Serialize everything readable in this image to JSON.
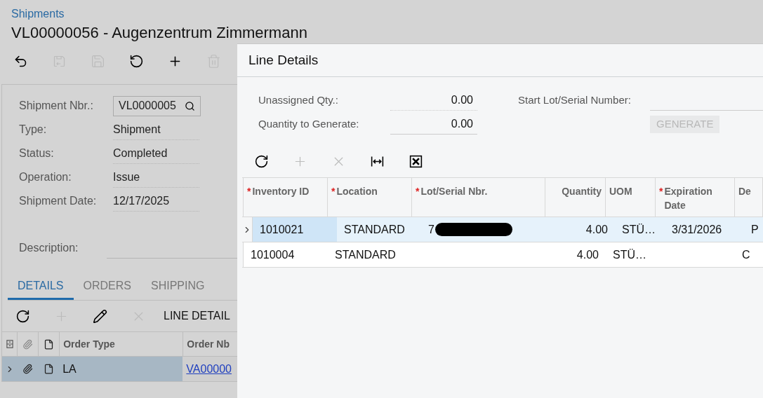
{
  "breadcrumb": "Shipments",
  "title": "VL00000056 - Augenzentrum Zimmermann",
  "toolbar": [
    {
      "kind": "back",
      "disabled": false
    },
    {
      "kind": "save-close",
      "disabled": true
    },
    {
      "kind": "save",
      "disabled": true
    },
    {
      "kind": "undo",
      "disabled": false
    },
    {
      "kind": "add",
      "disabled": false
    },
    {
      "kind": "delete",
      "disabled": true
    }
  ],
  "form": [
    {
      "label": "Shipment Nbr.:",
      "value": "VL0000005",
      "kind": "lookup"
    },
    {
      "label": "Type:",
      "value": "Shipment",
      "kind": "text"
    },
    {
      "label": "Status:",
      "value": "Completed",
      "kind": "text"
    },
    {
      "label": "Operation:",
      "value": "Issue",
      "kind": "text"
    },
    {
      "label": "Shipment Date:",
      "value": "12/17/2025",
      "kind": "text"
    },
    {
      "label": "Description:",
      "kind": "text"
    }
  ],
  "tabs": [
    {
      "label": "DETAILS",
      "selected": true
    },
    {
      "label": "ORDERS",
      "selected": false
    },
    {
      "label": "SHIPPING",
      "selected": false
    }
  ],
  "grid_toolbar": [
    {
      "kind": "refresh",
      "disabled": false
    },
    {
      "kind": "add",
      "disabled": true
    },
    {
      "kind": "edit",
      "disabled": false
    },
    {
      "kind": "delete",
      "disabled": true
    },
    {
      "kind": "text",
      "label": "LINE DETAIL",
      "disabled": false
    }
  ],
  "grid": {
    "columns": [
      "Order Type",
      "Order Nb"
    ],
    "rows": [
      {
        "selected": true,
        "cells": [
          "LA",
          "VA00000"
        ]
      }
    ]
  },
  "dialog": {
    "title": "Line Details",
    "fields": [
      {
        "label": "Unassigned Qty.:",
        "value": "0.00"
      },
      {
        "label": "Quantity to Generate:",
        "value": "0.00"
      }
    ],
    "start_field": {
      "label": "Start Lot/Serial Number:"
    },
    "generate_button": {
      "label": "GENERATE",
      "disabled": true
    },
    "toolbar": [
      {
        "kind": "refresh",
        "disabled": false
      },
      {
        "kind": "add",
        "disabled": true
      },
      {
        "kind": "delete",
        "disabled": true
      },
      {
        "kind": "fit",
        "disabled": false
      },
      {
        "kind": "excel",
        "disabled": false
      }
    ],
    "required_mark": "*",
    "columns": [
      {
        "label": "Inventory ID",
        "required": true,
        "kind": "text"
      },
      {
        "label": "Location",
        "required": true,
        "kind": "text"
      },
      {
        "label": "Lot/Serial Nbr.",
        "required": true,
        "kind": "text"
      },
      {
        "label": "Quantity",
        "required": false,
        "kind": "number"
      },
      {
        "label": "UOM",
        "required": false,
        "kind": "text"
      },
      {
        "label": "Expiration Date",
        "required": true,
        "kind": "text"
      },
      {
        "label": "De",
        "required": false,
        "kind": "text"
      }
    ],
    "rows": [
      {
        "selected": true,
        "redacted": true,
        "cells": [
          "1010021",
          "STANDARD",
          "7",
          "4.00",
          "STÜ…",
          "3/31/2026",
          "P"
        ]
      },
      {
        "selected": false,
        "redacted": false,
        "cells": [
          "1010004",
          "STANDARD",
          "",
          "4.00",
          "STÜ…",
          "",
          "C"
        ]
      }
    ]
  }
}
